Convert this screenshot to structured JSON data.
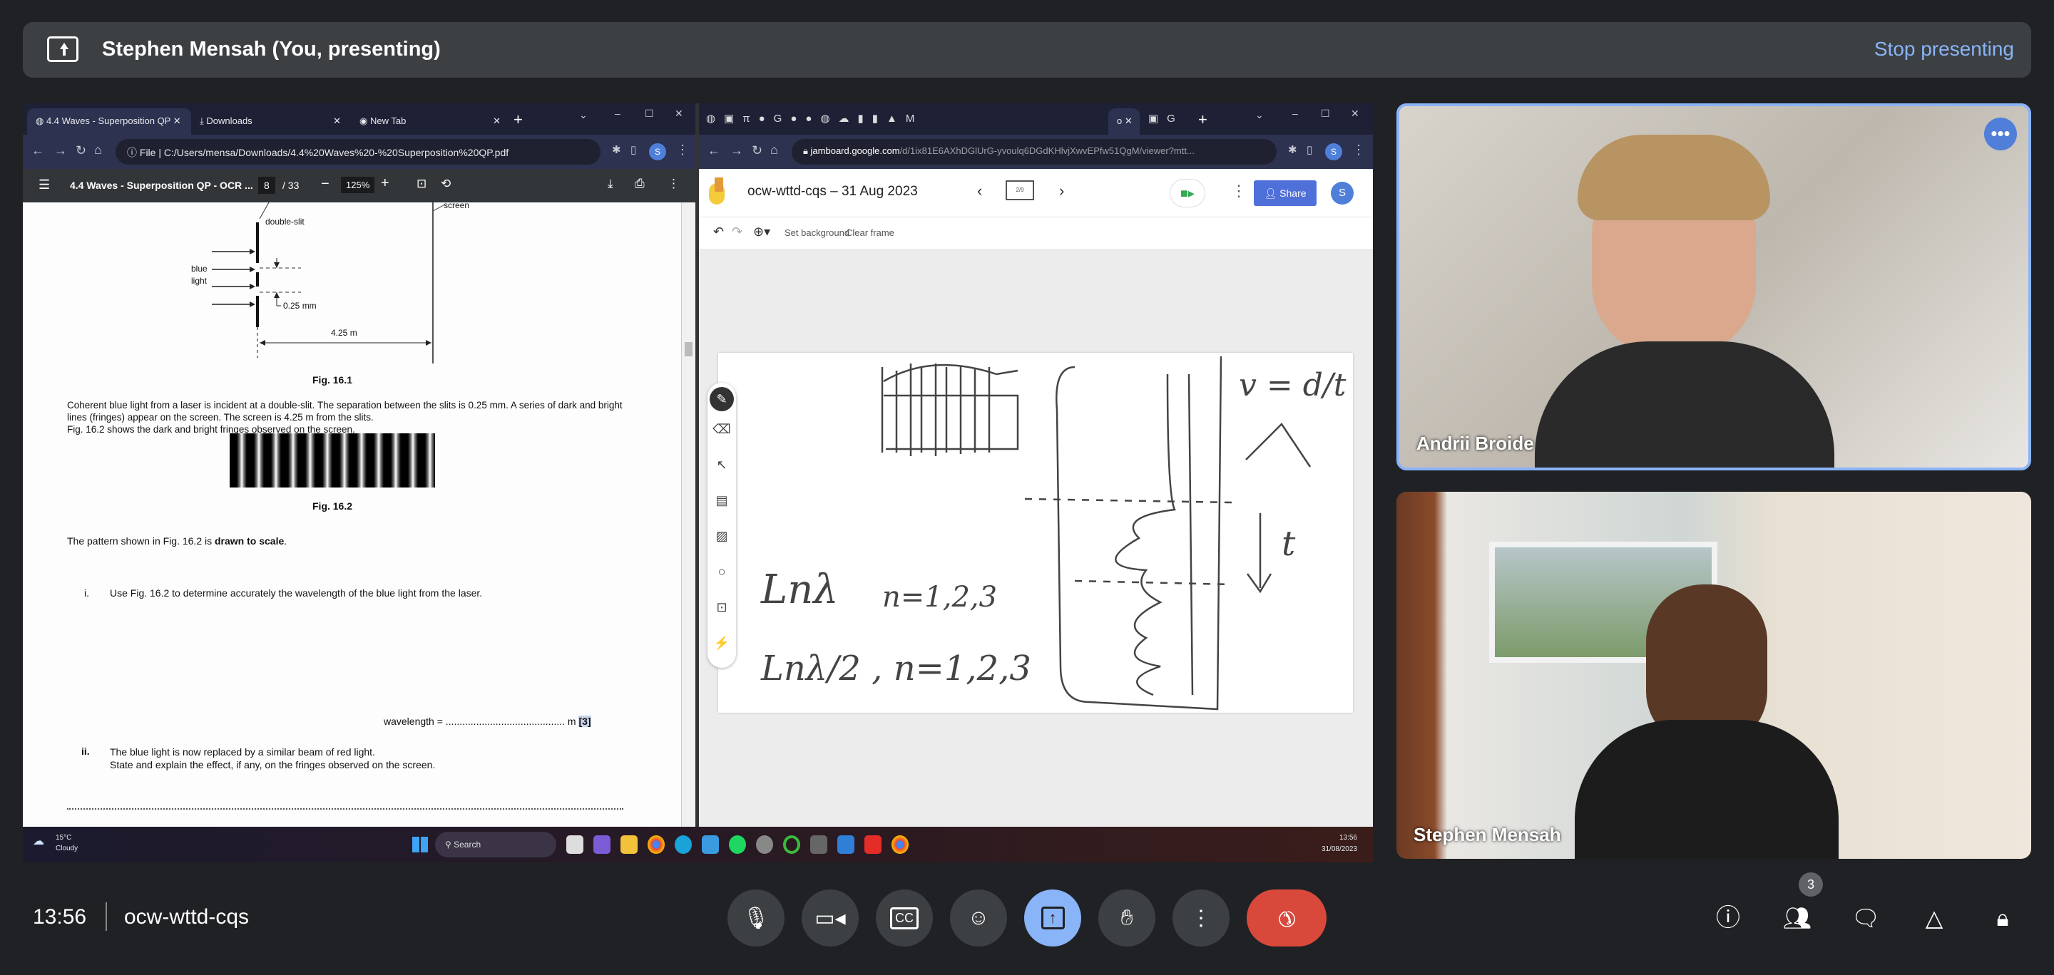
{
  "presenting_bar": {
    "title": "Stephen Mensah (You, presenting)",
    "stop_label": "Stop presenting"
  },
  "left_browser": {
    "tabs": [
      {
        "label": "4.4 Waves - Superposition QP"
      },
      {
        "label": "Downloads"
      },
      {
        "label": "New Tab"
      }
    ],
    "url_prefix": "File",
    "url": "C:/Users/mensa/Downloads/4.4%20Waves%20-%20Superposition%20QP.pdf",
    "avatar": "S",
    "pdf": {
      "title": "4.4 Waves - Superposition QP - OCR ...",
      "page": "8",
      "page_total": "/ 33",
      "zoom": "125%"
    },
    "doc": {
      "screen_label": "screen",
      "double_slit_label": "double-slit",
      "blue": "blue",
      "light": "light",
      "sep_label": "0.25 mm",
      "dist_label": "4.25 m",
      "fig1": "Fig. 16.1",
      "para1": "Coherent blue light from a laser is incident at a double-slit. The separation between the slits is 0.25 mm. A series of dark and bright lines (fringes) appear on the screen. The screen is 4.25 m from the slits.",
      "para2": "Fig. 16.2 shows the dark and bright fringes observed on the screen.",
      "fig2": "Fig. 16.2",
      "scale_pre": "The pattern shown in Fig. 16.2 is ",
      "scale_bold": "drawn to scale",
      "scale_post": ".",
      "q1_num": "i.",
      "q1": "Use Fig. 16.2 to determine accurately the wavelength of the blue light from the laser.",
      "answer_label": "wavelength = ........................................... m",
      "marks": "[3]",
      "q2_num": "ii.",
      "q2a": "The blue light is now replaced by a similar beam of red light.",
      "q2b": "State and explain the effect, if any, on the fringes observed on the screen."
    }
  },
  "right_browser": {
    "url_host": "jamboard.google.com",
    "url_path": "/d/1ix81E6AXhDGlUrG-yvoulq6DGdKHlvjXwvEPfw51QgM/viewer?mtt...",
    "avatar": "S",
    "jam": {
      "title": "ocw-wttd-cqs – 31 Aug 2023",
      "frame": "2/9",
      "share": "Share",
      "user": "S",
      "set_bg": "Set background",
      "clear": "Clear frame"
    },
    "ink": {
      "a": "Lnλ",
      "b": "n=1,2,3",
      "c": "Lnλ/2 , n=1,2,3",
      "d": "v = d/t",
      "e": "t"
    }
  },
  "taskbar": {
    "temp": "15°C",
    "weather": "Cloudy",
    "search": "Search",
    "time": "13:56",
    "date": "31/08/2023"
  },
  "participants": [
    {
      "name": "Andrii Broide"
    },
    {
      "name": "Stephen Mensah"
    }
  ],
  "meeting": {
    "time": "13:56",
    "code": "ocw-wttd-cqs",
    "people_count": "3"
  },
  "colors": {
    "accent": "#8ab4f8",
    "end_call": "#d9493b",
    "jam_share": "#4f6fd9"
  }
}
